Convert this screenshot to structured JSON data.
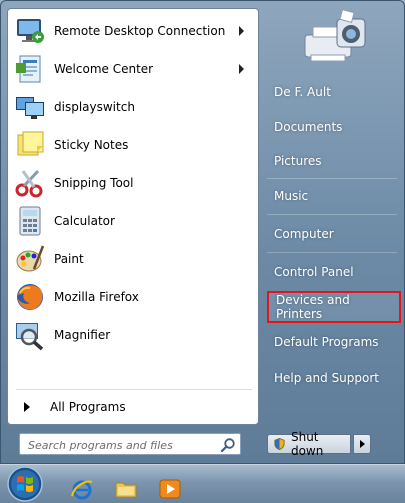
{
  "programs": [
    {
      "label": "Remote Desktop Connection",
      "icon": "remote-desktop-icon",
      "has_submenu": true
    },
    {
      "label": "Welcome Center",
      "icon": "welcome-center-icon",
      "has_submenu": true
    },
    {
      "label": "displayswitch",
      "icon": "displayswitch-icon",
      "has_submenu": false
    },
    {
      "label": "Sticky Notes",
      "icon": "sticky-notes-icon",
      "has_submenu": false
    },
    {
      "label": "Snipping Tool",
      "icon": "scissors-icon",
      "has_submenu": false
    },
    {
      "label": "Calculator",
      "icon": "calculator-icon",
      "has_submenu": false
    },
    {
      "label": "Paint",
      "icon": "paint-palette-icon",
      "has_submenu": false
    },
    {
      "label": "Mozilla Firefox",
      "icon": "firefox-icon",
      "has_submenu": false
    },
    {
      "label": "Magnifier",
      "icon": "magnifier-icon",
      "has_submenu": false
    }
  ],
  "all_programs": {
    "label": "All Programs"
  },
  "search": {
    "placeholder": "Search programs and files",
    "value": ""
  },
  "right_items": [
    {
      "label": "De F. Ault",
      "highlight": false
    },
    {
      "label": "Documents",
      "highlight": false
    },
    {
      "label": "Pictures",
      "highlight": false
    },
    {
      "label": "Music",
      "highlight": false
    },
    {
      "label": "Computer",
      "highlight": false
    },
    {
      "label": "Control Panel",
      "highlight": false
    },
    {
      "label": "Devices and Printers",
      "highlight": true
    },
    {
      "label": "Default Programs",
      "highlight": false
    },
    {
      "label": "Help and Support",
      "highlight": false
    }
  ],
  "user_picture": {
    "icon": "printer-camera-icon"
  },
  "shutdown": {
    "label": "Shut down"
  },
  "taskbar": {
    "items": [
      {
        "icon": "windows-orb-icon"
      },
      {
        "icon": "internet-explorer-icon"
      },
      {
        "icon": "folder-icon"
      },
      {
        "icon": "media-player-icon"
      }
    ]
  },
  "colors": {
    "highlight_border": "#e5141a",
    "accent": "#6c8aa6"
  }
}
